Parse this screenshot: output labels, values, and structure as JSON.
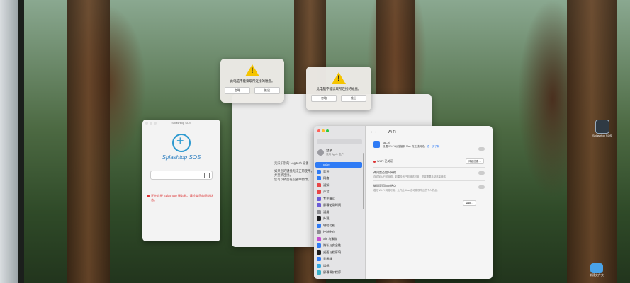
{
  "alerts": [
    {
      "message": "此电脑不能读取所连接的磁盘。",
      "buttons": [
        "忽略",
        "推出"
      ]
    },
    {
      "message": "此电脑不能读取所连接的磁盘。",
      "buttons": [
        "忽略",
        "推出"
      ]
    }
  ],
  "splashtop": {
    "title": "Splashtop SOS",
    "brand": "Splashtop SOS",
    "code_placeholder": "·········",
    "error": "正在连接 Splashtop 服务器。请检查您的网络状态。"
  },
  "center_window": {
    "line1": "无法识别的 Logitech 设备",
    "line2": "如果您的键盘无法正常使用，请断开并重新连接。",
    "line3": "您可以稍后在设置中更改。"
  },
  "settings": {
    "user_name": "登录",
    "user_sub": "使用 Apple 账户",
    "sidebar": [
      "Wi-Fi",
      "蓝牙",
      "网络",
      "通知",
      "声音",
      "专注模式",
      "屏幕使用时间",
      "通用",
      "外观",
      "辅助功能",
      "控制中心",
      "Siri 与聚焦",
      "隐私与安全性",
      "桌面与程序坞",
      "显示器",
      "墙纸",
      "屏幕保护程序"
    ],
    "page_title": "Wi-Fi",
    "wifi_label": "Wi-Fi",
    "wifi_desc": "设置 Wi-Fi 以连接到 Mac 的无线网络。",
    "wifi_link": "进一步了解",
    "status": "Wi-Fi 已关闭",
    "details_btn": "详细信息…",
    "ask_join_title": "询问是否加入网络",
    "ask_join_desc": "自动加入已知网络。如果没有已知网络可用，您将需要手动选择网络。",
    "ask_hotspot_title": "询问是否加入热点",
    "ask_hotspot_desc": "若无 Wi-Fi 网络可用，允许此 Mac 自动发现附近的个人热点。",
    "advanced_btn": "高级…"
  },
  "desktop": {
    "splashtop_icon_label": "Splashtop SOS",
    "folder_label": "新建文件夹"
  }
}
